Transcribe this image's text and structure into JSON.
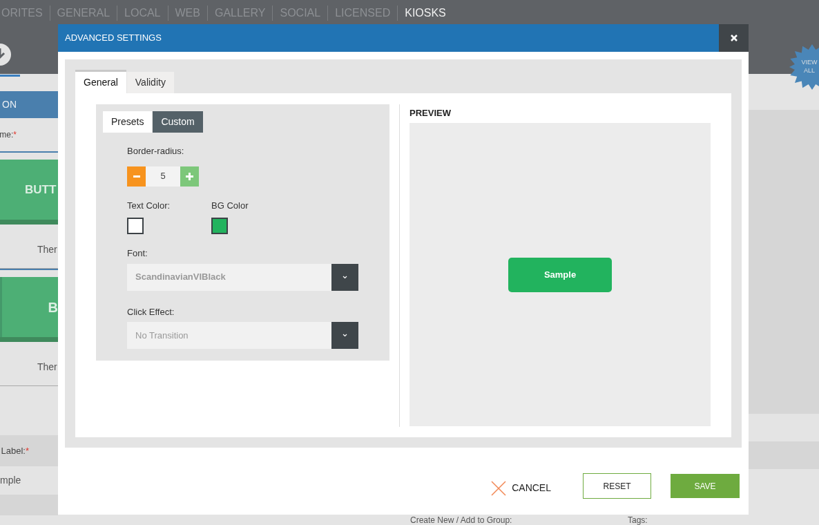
{
  "background": {
    "nav": [
      {
        "label": "ORITES",
        "selected": false
      },
      {
        "label": "GENERAL",
        "selected": false
      },
      {
        "label": "LOCAL",
        "selected": false
      },
      {
        "label": "WEB",
        "selected": false
      },
      {
        "label": "GALLERY",
        "selected": false
      },
      {
        "label": "SOCIAL",
        "selected": false
      },
      {
        "label": "LICENSED",
        "selected": false
      },
      {
        "label": "KIOSKS",
        "selected": true
      }
    ],
    "view_all": "VIEW ALL",
    "left_panel": {
      "header": "ON",
      "name_label": {
        "text": "me:",
        "mark": "*"
      },
      "button_previews": [
        {
          "kind": "plain",
          "label": "BUTT",
          "theme": "Ther"
        },
        {
          "kind": "split",
          "label": "B",
          "theme": "Ther"
        }
      ],
      "label_field": {
        "text": "Label:",
        "mark": "*"
      },
      "label_value": "mple"
    },
    "bottom_strip": [
      "Create New / Add to Group:",
      "Tags:"
    ]
  },
  "modal": {
    "title": "ADVANCED SETTINGS",
    "tabs": [
      {
        "label": "General",
        "selected": true
      },
      {
        "label": "Validity",
        "selected": false
      }
    ],
    "mode_tabs": [
      {
        "label": "Presets",
        "selected": false
      },
      {
        "label": "Custom",
        "selected": true
      }
    ],
    "border_radius": {
      "label": "Border-radius:",
      "value": "5"
    },
    "text_color": {
      "label": "Text Color:",
      "color": "#ffffff"
    },
    "bg_color": {
      "label": "BG Color",
      "color": "#22b35e"
    },
    "font": {
      "label": "Font:",
      "value": "ScandinavianVIBlack"
    },
    "click_effect": {
      "label": "Click Effect:",
      "value": "No Transition"
    },
    "preview": {
      "title": "PREVIEW",
      "sample": "Sample"
    },
    "buttons": {
      "cancel": "CANCEL",
      "reset": "RESET",
      "save": "SAVE"
    }
  }
}
